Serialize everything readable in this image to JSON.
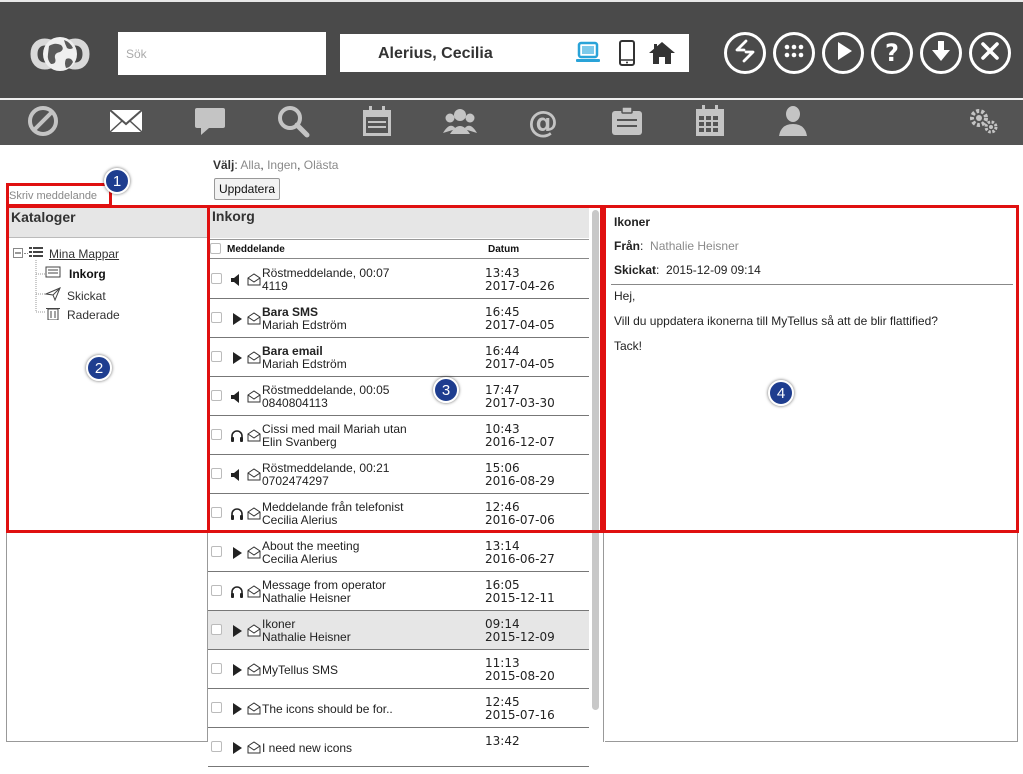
{
  "header": {
    "search_placeholder": "Sök",
    "user_name": "Alerius, Cecilia",
    "device_icons": [
      "desktop-icon",
      "mobile-icon",
      "home-icon"
    ],
    "buttons": [
      "switch-icon",
      "apps-grid-icon",
      "play-icon",
      "help-icon",
      "download-icon",
      "close-icon"
    ]
  },
  "toolbar": {
    "icons": [
      "block-icon",
      "mail-icon",
      "chat-icon",
      "search-icon",
      "calendar-icon",
      "group-icon",
      "at-icon",
      "clipboard-icon",
      "schedule-icon",
      "user-icon",
      "settings-icon"
    ]
  },
  "select_bar": {
    "label": "Välj",
    "options": [
      "Alla",
      "Ingen",
      "Olästa"
    ],
    "update_button": "Uppdatera"
  },
  "compose_link": "Skriv meddelande",
  "catalogs": {
    "title": "Kataloger",
    "root": "Mina Mappar",
    "folders": [
      "Inkorg",
      "Skickat",
      "Raderade"
    ]
  },
  "inbox": {
    "title": "Inkorg",
    "col_message": "Meddelande",
    "col_date": "Datum",
    "rows": [
      {
        "icon": "speaker-icon",
        "line1": "Röstmeddelande, 00:07",
        "line2": "4119",
        "time": "13:43",
        "date": "2017-04-26",
        "bold": false
      },
      {
        "icon": "play-icon",
        "line1": "Bara SMS",
        "line2": "Mariah Edström",
        "time": "16:45",
        "date": "2017-04-05",
        "bold": true
      },
      {
        "icon": "play-icon",
        "line1": "Bara email",
        "line2": "Mariah Edström",
        "time": "16:44",
        "date": "2017-04-05",
        "bold": true
      },
      {
        "icon": "speaker-icon",
        "line1": "Röstmeddelande, 00:05",
        "line2": "0840804113",
        "time": "17:47",
        "date": "2017-03-30",
        "bold": false
      },
      {
        "icon": "headset-icon",
        "line1": "Cissi med mail Mariah utan",
        "line2": "Elin Svanberg",
        "time": "10:43",
        "date": "2016-12-07",
        "bold": false
      },
      {
        "icon": "speaker-icon",
        "line1": "Röstmeddelande, 00:21",
        "line2": "0702474297",
        "time": "15:06",
        "date": "2016-08-29",
        "bold": false
      },
      {
        "icon": "headset-icon",
        "line1": "Meddelande från telefonist",
        "line2": "Cecilia Alerius",
        "time": "12:46",
        "date": "2016-07-06",
        "bold": false
      },
      {
        "icon": "play-icon",
        "line1": "About the meeting",
        "line2": "Cecilia Alerius",
        "time": "13:14",
        "date": "2016-06-27",
        "bold": false
      },
      {
        "icon": "headset-icon",
        "line1": "Message from operator",
        "line2": "Nathalie Heisner",
        "time": "16:05",
        "date": "2015-12-11",
        "bold": false
      },
      {
        "icon": "play-icon",
        "line1": "Ikoner",
        "line2": "Nathalie Heisner",
        "time": "09:14",
        "date": "2015-12-09",
        "bold": false,
        "selected": true
      },
      {
        "icon": "play-icon",
        "line1": "MyTellus SMS",
        "line2": "",
        "time": "11:13",
        "date": "2015-08-20",
        "bold": false
      },
      {
        "icon": "play-icon",
        "line1": "The icons should be for..",
        "line2": "",
        "time": "12:45",
        "date": "2015-07-16",
        "bold": false
      },
      {
        "icon": "play-icon",
        "line1": "I need new icons",
        "line2": "",
        "time": "13:42",
        "date": "",
        "bold": false
      }
    ]
  },
  "message": {
    "subject": "Ikoner",
    "from_label": "Från",
    "from": "Nathalie Heisner",
    "sent_label": "Skickat",
    "sent": "2015-12-09 09:14",
    "body": [
      "Hej,",
      "Vill du uppdatera ikonerna till MyTellus så att de blir flattified?",
      "Tack!"
    ]
  },
  "annotations": [
    "1",
    "2",
    "3",
    "4"
  ],
  "colors": {
    "header_bg": "#4a4a4a",
    "toolbar_bg": "#545454",
    "toolbar_icon": "#c4c4c4",
    "accent_blue": "#29a3d8",
    "annotation_red": "#e01010",
    "marker_blue": "#1e3d8f"
  }
}
